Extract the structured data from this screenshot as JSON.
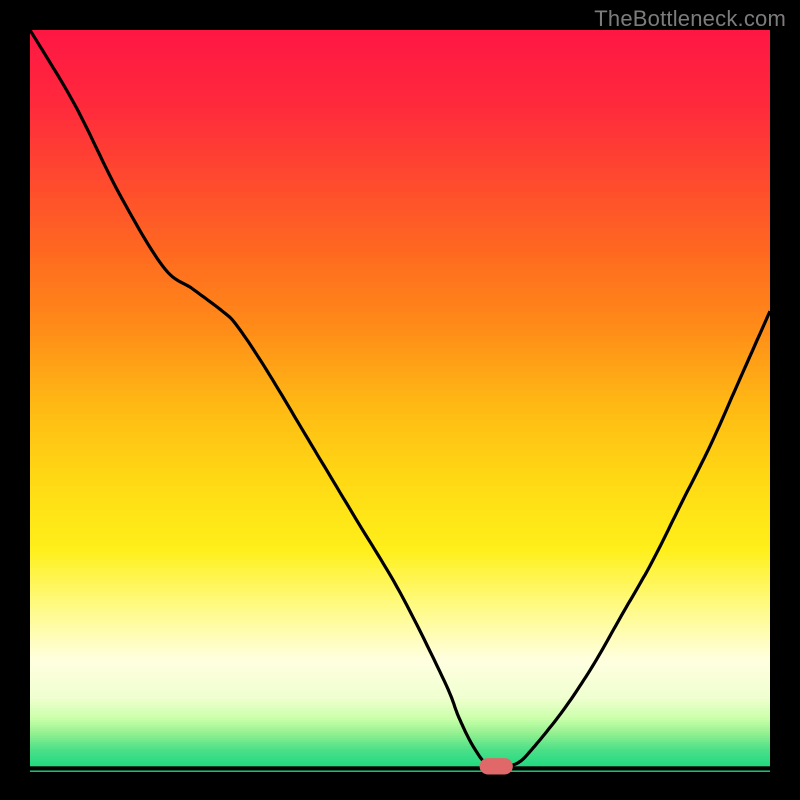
{
  "watermark": "TheBottleneck.com",
  "chart_data": {
    "type": "line",
    "title": "",
    "xlabel": "",
    "ylabel": "",
    "xlim": [
      0,
      100
    ],
    "ylim": [
      0,
      100
    ],
    "gradient_bands": [
      {
        "y": 0,
        "color": "#ff1744"
      },
      {
        "y": 10,
        "color": "#ff2a3c"
      },
      {
        "y": 20,
        "color": "#ff4a2e"
      },
      {
        "y": 30,
        "color": "#ff6a20"
      },
      {
        "y": 40,
        "color": "#ff8c18"
      },
      {
        "y": 50,
        "color": "#ffb814"
      },
      {
        "y": 60,
        "color": "#ffd814"
      },
      {
        "y": 70,
        "color": "#fff01a"
      },
      {
        "y": 78,
        "color": "#fffb88"
      },
      {
        "y": 85,
        "color": "#ffffe0"
      },
      {
        "y": 90,
        "color": "#f0ffd0"
      },
      {
        "y": 93,
        "color": "#c8ffa8"
      },
      {
        "y": 95,
        "color": "#90f090"
      },
      {
        "y": 97,
        "color": "#50e088"
      },
      {
        "y": 100,
        "color": "#16d880"
      }
    ],
    "series": [
      {
        "name": "bottleneck-curve",
        "x": [
          0,
          6,
          12,
          18,
          22,
          26,
          28,
          32,
          38,
          44,
          50,
          56,
          58,
          60,
          62,
          64,
          66,
          68,
          72,
          76,
          80,
          84,
          88,
          92,
          96,
          100
        ],
        "y": [
          0,
          10,
          22,
          32,
          35,
          38,
          40,
          46,
          56,
          66,
          76,
          88,
          93,
          97,
          99.5,
          99.5,
          99,
          97,
          92,
          86,
          79,
          72,
          64,
          56,
          47,
          38
        ]
      }
    ],
    "marker": {
      "x_center": 63,
      "y": 99.5,
      "width": 4.5,
      "height": 2.2,
      "color": "#e06868"
    },
    "baseline_y": 99.5
  }
}
